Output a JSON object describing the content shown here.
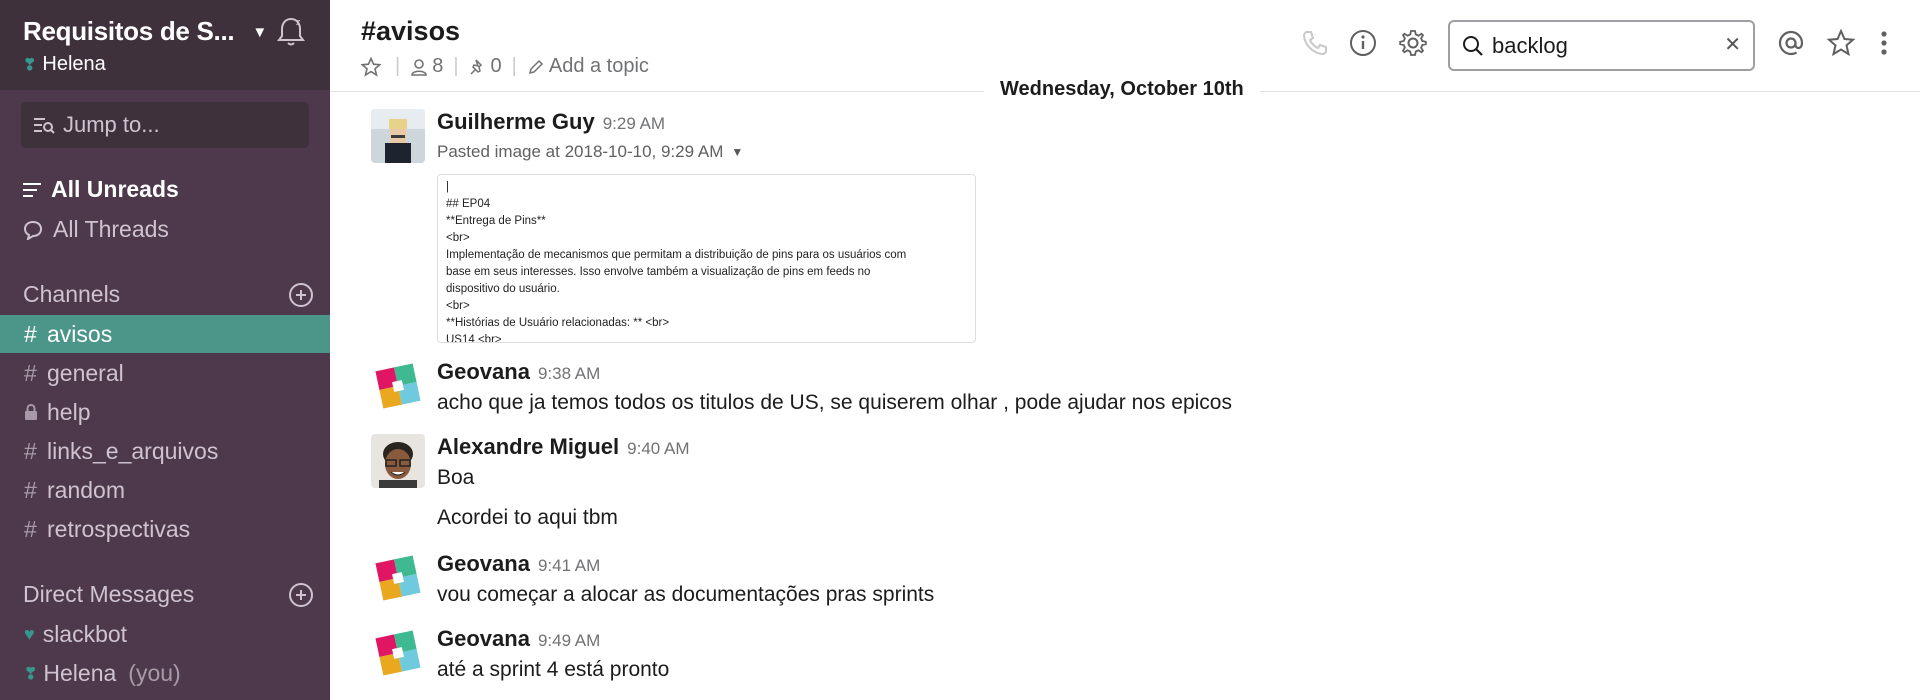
{
  "workspace": {
    "name": "Requisitos de S...",
    "user": "Helena"
  },
  "sidebar": {
    "jump_placeholder": "Jump to...",
    "all_unreads": "All Unreads",
    "all_threads": "All Threads",
    "channels_heading": "Channels",
    "channels": [
      {
        "name": "avisos",
        "prefix": "#",
        "active": true
      },
      {
        "name": "general",
        "prefix": "#"
      },
      {
        "name": "help",
        "prefix": "lock"
      },
      {
        "name": "links_e_arquivos",
        "prefix": "#"
      },
      {
        "name": "random",
        "prefix": "#"
      },
      {
        "name": "retrospectivas",
        "prefix": "#"
      }
    ],
    "dm_heading": "Direct Messages",
    "dms": [
      {
        "name": "slackbot"
      },
      {
        "name": "Helena",
        "suffix": "(you)"
      }
    ]
  },
  "header": {
    "channel_title": "#avisos",
    "members_count": "8",
    "pins_count": "0",
    "add_topic": "Add a topic",
    "search_value": "backlog"
  },
  "date_divider": "Wednesday, October 10th",
  "messages": [
    {
      "author": "Guilherme Guy",
      "time": "9:29 AM",
      "pasted": "Pasted image at 2018-10-10, 9:29 AM",
      "preview_lines": [
        "|",
        "## EP04",
        "**Entrega de Pins**",
        "<br>",
        "Implementação de mecanismos que permitam a distribuição de pins para os usuários com",
        "base em seus interesses. Isso envolve também a visualização de pins em feeds no",
        "dispositivo do usuário.",
        "<br>",
        "**Histórias de Usuário relacionadas: ** <br>",
        "US14 <br>"
      ]
    },
    {
      "author": "Geovana",
      "time": "9:38 AM",
      "text": "acho que ja temos todos os titulos de US, se quiserem olhar , pode ajudar nos epicos"
    },
    {
      "author": "Alexandre Miguel",
      "time": "9:40 AM",
      "text": "Boa",
      "text2": "Acordei to aqui tbm"
    },
    {
      "author": "Geovana",
      "time": "9:41 AM",
      "text": "vou começar a alocar as documentações pras sprints"
    },
    {
      "author": "Geovana",
      "time": "9:49 AM",
      "text": "até a sprint 4 está pronto"
    }
  ],
  "colors": {
    "sidebar_bg": "#4d394b",
    "active_channel": "#4c9689",
    "presence": "#38978d"
  }
}
